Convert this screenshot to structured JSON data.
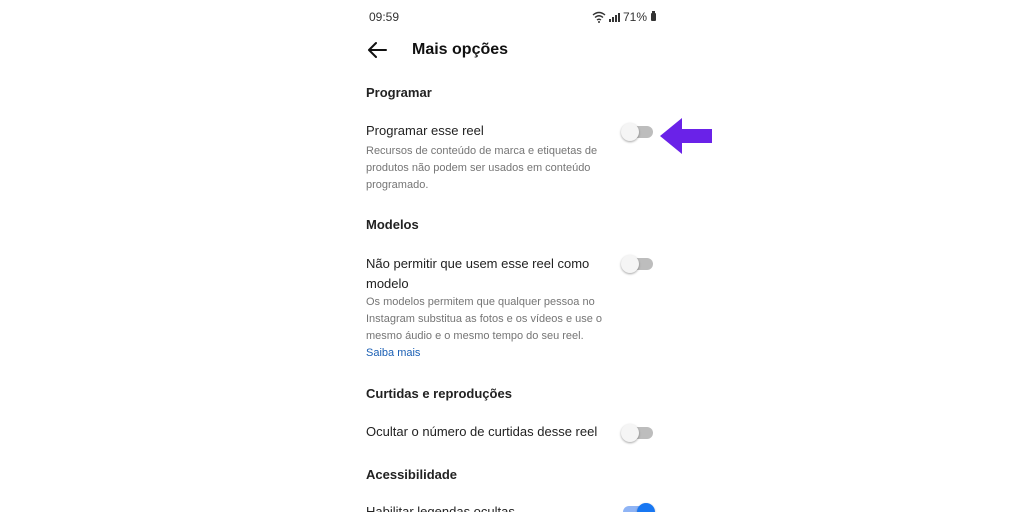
{
  "status_bar": {
    "time": "09:59",
    "battery": "71%",
    "icons": [
      "wifi-icon",
      "signal-icon",
      "battery-icon"
    ]
  },
  "header": {
    "back_icon": "arrow-left-icon",
    "title": "Mais opções"
  },
  "sections": {
    "schedule": {
      "title": "Programar",
      "item_label": "Programar esse reel",
      "item_desc": "Recursos de conteúdo de marca e etiquetas de produtos não podem ser usados em conteúdo programado.",
      "toggle_on": false
    },
    "templates": {
      "title": "Modelos",
      "item_label": "Não permitir que usem esse reel como modelo",
      "item_desc": "Os modelos permitem que qualquer pessoa no Instagram substitua as fotos e os vídeos e use o mesmo áudio e o mesmo tempo do seu reel.",
      "learn_more": "Saiba mais",
      "toggle_on": false
    },
    "likes": {
      "title": "Curtidas e reproduções",
      "item_label": "Ocultar o número de curtidas desse reel",
      "toggle_on": false
    },
    "accessibility": {
      "title": "Acessibilidade",
      "item_label": "Habilitar legendas ocultas",
      "toggle_on": true
    }
  },
  "colors": {
    "accent_arrow": "#6a22e8",
    "toggle_on": "#1877f2",
    "link": "#1a5fb4"
  }
}
